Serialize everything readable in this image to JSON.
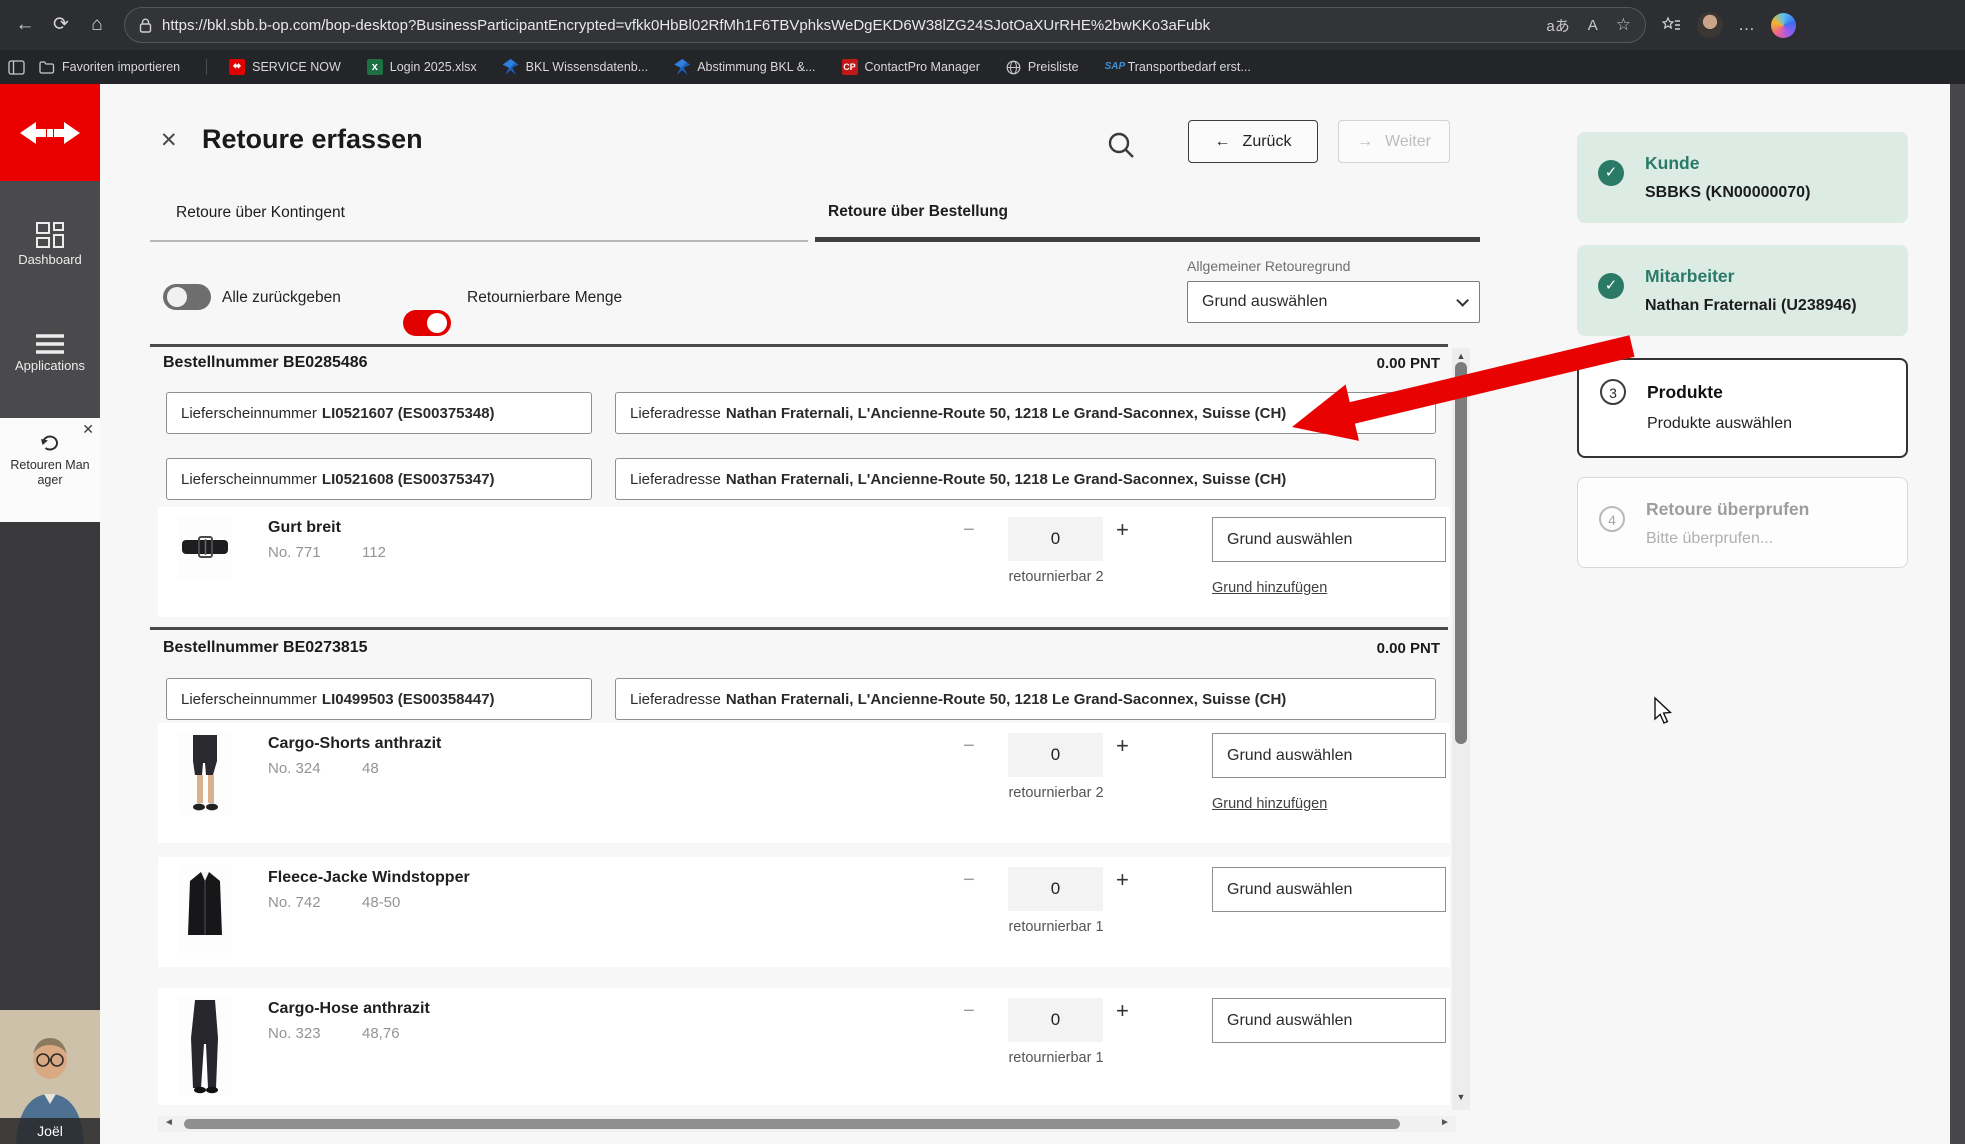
{
  "colors": {
    "brand_red": "#eb0000",
    "toggle_on": "#e30000",
    "step_done_bg": "#dcebe4",
    "step_done_text": "#2a7a67",
    "arrow_annotation": "#e90202"
  },
  "icons": {
    "back": "←",
    "forward": "→",
    "refresh": "⟳",
    "home": "⌂",
    "translate": "aあ",
    "read_aloud": "A",
    "star": "☆",
    "dots": "…",
    "close": "✕",
    "check": "✓",
    "minus": "−",
    "plus": "+",
    "up": "▲",
    "down": "▼",
    "left": "◄",
    "right": "►",
    "excel_x": "x",
    "cp": "CP",
    "sap": "SAP"
  },
  "browser": {
    "url": "https://bkl.sbb.b-op.com/bop-desktop?BusinessParticipantEncrypted=vfkk0HbBl02RfMh1F6TBVphksWeDgEKD6W38lZG24SJotOaXUrRHE%2bwKKo3aFubk",
    "favorites": {
      "import_label": "Favoriten importieren",
      "items": [
        "SERVICE NOW",
        "Login 2025.xlsx",
        "BKL Wissensdatenb...",
        "Abstimmung BKL &...",
        "ContactPro Manager",
        "Preisliste",
        "Transportbedarf erst..."
      ]
    }
  },
  "sidebar": {
    "dashboard_label": "Dashboard",
    "applications_label": "Applications",
    "retouren_line1": "Retouren Man",
    "retouren_line2": "ager",
    "profile_name": "Joël"
  },
  "header": {
    "title": "Retoure erfassen",
    "back_label": "Zurück",
    "next_label": "Weiter"
  },
  "tabs": {
    "tab1": "Retoure über Kontingent",
    "tab2": "Retoure über Bestellung"
  },
  "filters": {
    "toggle_all_label": "Alle zurückgeben",
    "toggle_returnable_label": "Retournierbare Menge",
    "general_reason_label": "Allgemeiner Retouregrund",
    "reason_placeholder": "Grund auswählen",
    "add_reason_label": "Grund hinzufügen",
    "ls_label": "Lieferscheinnummer",
    "addr_label": "Lieferadresse"
  },
  "orders": [
    {
      "number": "Bestellnummer BE0285486",
      "points": "0.00 PNT",
      "shipments": [
        {
          "ls": "LI0521607 (ES00375348)",
          "addr": "Nathan Fraternali, L'Ancienne-Route 50, 1218 Le Grand-Saconnex, Suisse (CH)"
        },
        {
          "ls": "LI0521608 (ES00375347)",
          "addr": "Nathan Fraternali, L'Ancienne-Route 50, 1218 Le Grand-Saconnex, Suisse (CH)"
        }
      ],
      "products": [
        {
          "title": "Gurt breit",
          "no": "No. 771",
          "size": "112",
          "qty": "0",
          "returnable": "retournierbar 2"
        }
      ]
    },
    {
      "number": "Bestellnummer BE0273815",
      "points": "0.00 PNT",
      "shipments": [
        {
          "ls": "LI0499503 (ES00358447)",
          "addr": "Nathan Fraternali, L'Ancienne-Route 50, 1218 Le Grand-Saconnex, Suisse (CH)"
        }
      ],
      "products": [
        {
          "title": "Cargo-Shorts anthrazit",
          "no": "No. 324",
          "size": "48",
          "qty": "0",
          "returnable": "retournierbar 2"
        },
        {
          "title": "Fleece-Jacke Windstopper",
          "no": "No. 742",
          "size": "48-50",
          "qty": "0",
          "returnable": "retournierbar 1"
        },
        {
          "title": "Cargo-Hose anthrazit",
          "no": "No. 323",
          "size": "48,76",
          "qty": "0",
          "returnable": "retournierbar 1"
        }
      ]
    }
  ],
  "steps": [
    {
      "number": "",
      "title": "Kunde",
      "subtitle": "SBBKS (KN00000070)"
    },
    {
      "number": "",
      "title": "Mitarbeiter",
      "subtitle": "Nathan Fraternali (U238946)"
    },
    {
      "number": "3",
      "title": "Produkte",
      "subtitle": "Produkte auswählen"
    },
    {
      "number": "4",
      "title": "Retoure überprufen",
      "subtitle": "Bitte überprufen..."
    }
  ]
}
